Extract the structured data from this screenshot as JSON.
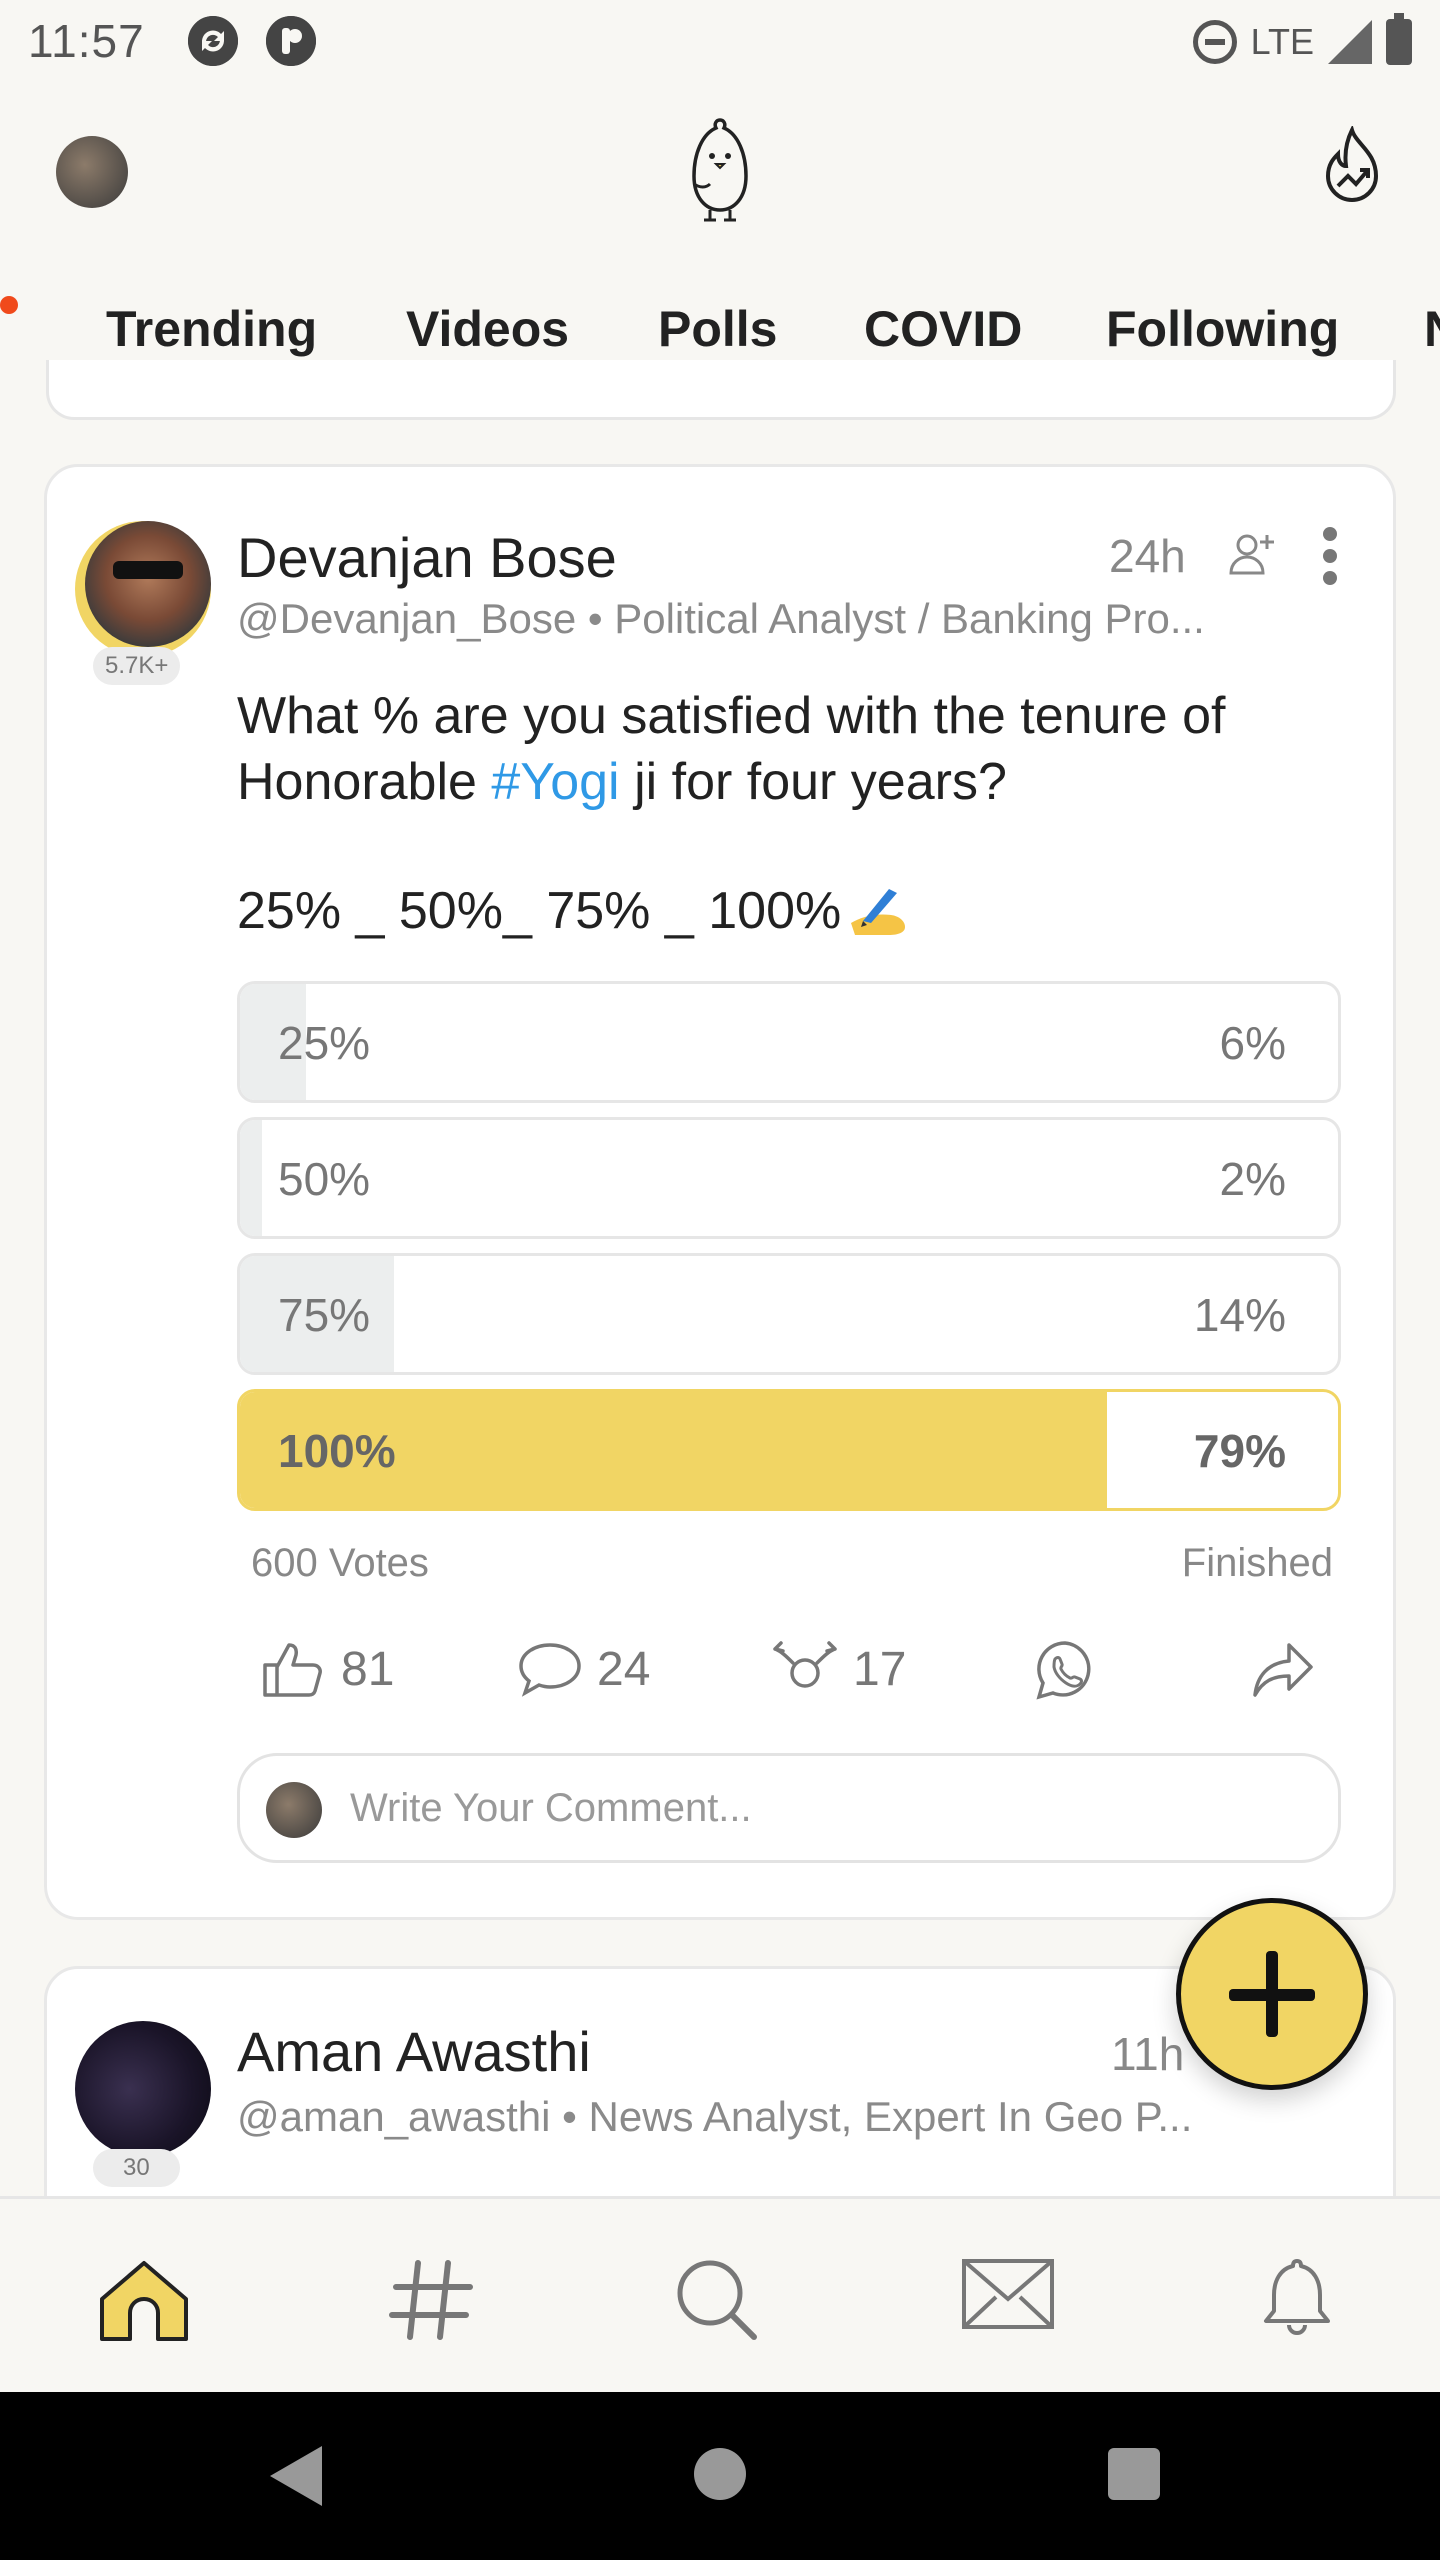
{
  "status_bar": {
    "time": "11:57",
    "network": "LTE",
    "icons": [
      "app-sync-icon",
      "app-bolt-icon",
      "do-not-disturb-icon",
      "signal-icon",
      "battery-icon"
    ]
  },
  "app_bar": {
    "profile_icon": "avatar",
    "logo_icon": "koo-bird-icon",
    "trending_icon": "trending-flame-icon"
  },
  "tabs": [
    {
      "label": "Trending",
      "active": false
    },
    {
      "label": "Videos",
      "active": false
    },
    {
      "label": "Polls",
      "active": true
    },
    {
      "label": "COVID",
      "active": false
    },
    {
      "label": "Following",
      "active": false
    },
    {
      "label": "N",
      "active": false
    }
  ],
  "post": {
    "author": "Devanjan Bose",
    "avatar_badge": "5.7K+",
    "time": "24h",
    "handle_line": "@Devanjan_Bose • Political Analyst / Banking Pro...",
    "question_before": "What % are you satisfied with the tenure of Honorable ",
    "hashtag": "#Yogi",
    "question_after": " ji for four years?",
    "options_text": "25% _ 50%_ 75% _ 100%",
    "poll": [
      {
        "label": "25%",
        "percent_text": "6%",
        "value": 6
      },
      {
        "label": "50%",
        "percent_text": "2%",
        "value": 2
      },
      {
        "label": "75%",
        "percent_text": "14%",
        "value": 14
      },
      {
        "label": "100%",
        "percent_text": "79%",
        "value": 79
      }
    ],
    "votes": "600 Votes",
    "status": "Finished",
    "actions": {
      "likes": "81",
      "comments": "24",
      "rekoos": "17"
    },
    "comment_placeholder": "Write Your Comment..."
  },
  "next_post": {
    "author": "Aman Awasthi",
    "avatar_badge": "30",
    "time": "11h",
    "handle_line": "@aman_awasthi • News Analyst, Expert In Geo P..."
  },
  "colors": {
    "accent": "#f1d564",
    "hashtag": "#2f99e6",
    "notification_dot": "#f04a1b"
  },
  "bottom_nav": [
    "home-icon",
    "hashtag-icon",
    "search-icon",
    "mail-icon",
    "bell-icon"
  ]
}
